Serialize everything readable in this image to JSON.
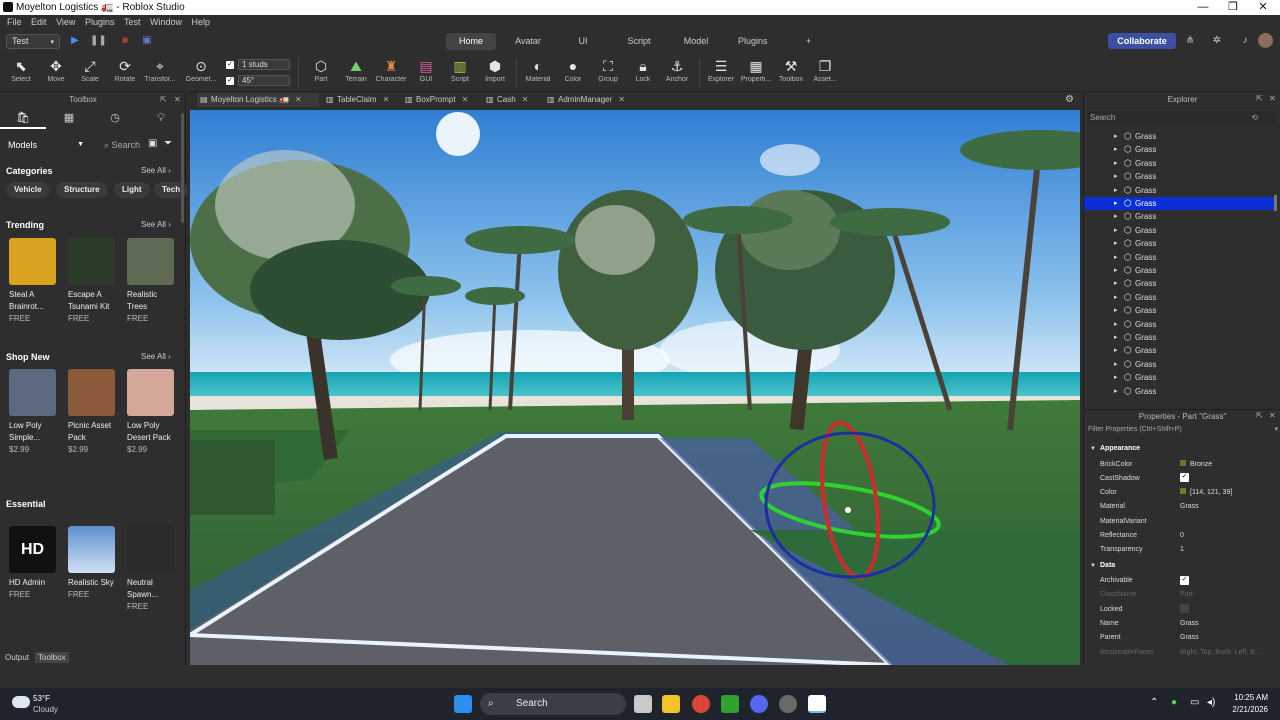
{
  "window": {
    "title": "Moyelton Logistics 🚛 - Roblox Studio",
    "minimize": "—",
    "maximize": "❐",
    "close": "✕"
  },
  "menu": [
    "File",
    "Edit",
    "View",
    "Plugins",
    "Test",
    "Window",
    "Help"
  ],
  "topbar": {
    "mode": "Test",
    "tabs": [
      "Home",
      "Avatar",
      "UI",
      "Script",
      "Model",
      "Plugins"
    ],
    "active_tab": "Home",
    "add_tab": "+",
    "collaborate": "Collaborate"
  },
  "toolbar": {
    "tools": [
      "Select",
      "Move",
      "Scale",
      "Rotate",
      "Transfor...",
      "Geomet..."
    ],
    "snap_move": "1 studs",
    "snap_rotate": "45°",
    "insert_tools": [
      "Part",
      "Terrain",
      "Character",
      "GUI",
      "Script",
      "Import"
    ],
    "edit_tools": [
      "Material",
      "Color",
      "Group",
      "Lock",
      "Anchor"
    ],
    "view_tools": [
      "Explorer",
      "Properti...",
      "Toolbox",
      "Asset..."
    ]
  },
  "toolbox": {
    "title": "Toolbox",
    "category_select": "Models",
    "search_placeholder": "Search",
    "categories_label": "Categories",
    "see_all": "See All",
    "categories": [
      "Vehicle",
      "Structure",
      "Light",
      "Tech"
    ],
    "trending_label": "Trending",
    "trending": [
      {
        "name": "Steal A Brainrot...",
        "price": "FREE",
        "color": "#d9a320"
      },
      {
        "name": "Escape A Tsunami Kit",
        "price": "FREE",
        "color": "#2d3b2a"
      },
      {
        "name": "Realistic Trees",
        "price": "FREE",
        "color": "#5f6b55"
      }
    ],
    "shop_label": "Shop New",
    "shop": [
      {
        "name": "Low Poly Simple...",
        "price": "$2.99",
        "color": "#5c6a80"
      },
      {
        "name": "Picnic Asset Pack",
        "price": "$2.99",
        "color": "#8a5a3a"
      },
      {
        "name": "Low Poly Desert Pack",
        "price": "$2.99",
        "color": "#d4a79a"
      }
    ],
    "essential_label": "Essential",
    "essential": [
      {
        "name": "HD Admin",
        "price": "FREE",
        "color": "#111111",
        "badge": "HD"
      },
      {
        "name": "Realistic Sky",
        "price": "FREE",
        "color": "#7aa6d6",
        "badge": ""
      },
      {
        "name": "Neutral Spawn...",
        "price": "FREE",
        "color": "#2a2a2a",
        "badge": ""
      }
    ],
    "bottom_tabs": [
      "Output",
      "Toolbox"
    ]
  },
  "doc_tabs": [
    "Moyelton Logistics 🚛",
    "TableClaim",
    "BoxPrompt",
    "Cash",
    "AdminManager"
  ],
  "explorer": {
    "title": "Explorer",
    "search_placeholder": "Search",
    "item_label": "Grass",
    "selected_index": 5,
    "trailing": "Grass"
  },
  "properties": {
    "title": "Properties - Part \"Grass\"",
    "filter_placeholder": "Filter Properties (Ctrl+Shift+P)",
    "appearance_label": "Appearance",
    "appearance": [
      {
        "k": "BrickColor",
        "v": "Bronze",
        "swatch": "#7a6a2e"
      },
      {
        "k": "CastShadow",
        "v": "",
        "check": true
      },
      {
        "k": "Color",
        "v": "[114, 121, 39]",
        "swatch": "#727927"
      },
      {
        "k": "Material",
        "v": "Grass"
      },
      {
        "k": "MaterialVariant",
        "v": ""
      },
      {
        "k": "Reflectance",
        "v": "0"
      },
      {
        "k": "Transparency",
        "v": "1"
      }
    ],
    "data_label": "Data",
    "data": [
      {
        "k": "Archivable",
        "v": "",
        "check": true
      },
      {
        "k": "ClassName",
        "v": "Part",
        "dim": true
      },
      {
        "k": "Locked",
        "v": "",
        "box": true
      },
      {
        "k": "Name",
        "v": "Grass"
      },
      {
        "k": "Parent",
        "v": "Grass"
      },
      {
        "k": "ResizeableFaces",
        "v": "Right, Top, Back, Left, B...",
        "dim": true
      }
    ]
  },
  "taskbar": {
    "weather_temp": "53°F",
    "weather_desc": "Cloudy",
    "search": "Search",
    "time": "10:25 AM",
    "date": "2/21/2026"
  }
}
